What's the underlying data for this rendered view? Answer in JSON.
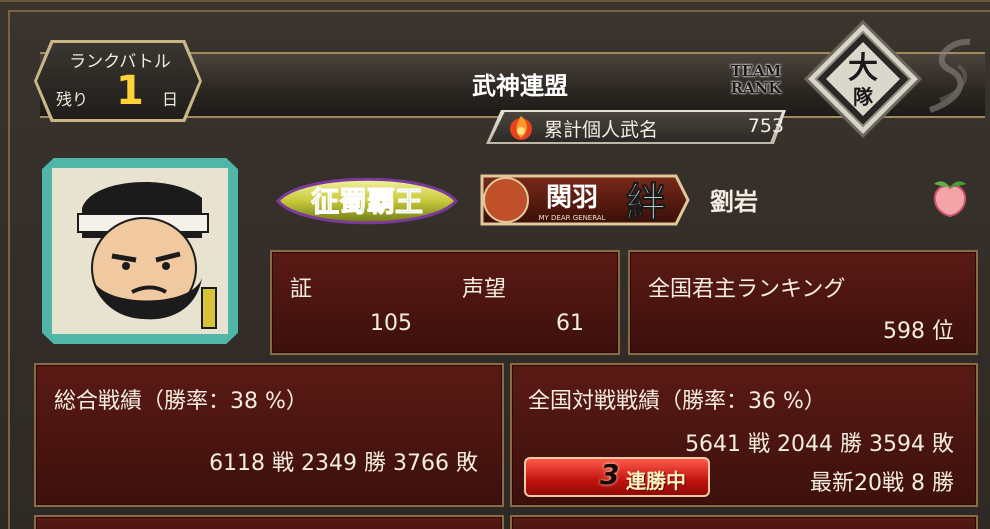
{
  "header": {
    "rank_battle_title": "ランクバトル",
    "remaining_label": "残り",
    "remaining_value": "1",
    "remaining_unit": "日",
    "alliance_name": "武神連盟",
    "team_rank_label_line1": "TEAM",
    "team_rank_label_line2": "RANK",
    "team_rank_emblem_text": "大隊",
    "merit_label": "累計個人武名",
    "merit_value": "753"
  },
  "player": {
    "name": "劉岩",
    "title_1": "征蜀覇王",
    "title_2_name": "関羽",
    "title_2_sub": "MY DEAR GENERAL",
    "title_2_kanji": "絆"
  },
  "stats": {
    "proof_label": "証",
    "proof_value": "105",
    "fame_label": "声望",
    "fame_value": "61",
    "national_ranking_label": "全国君主ランキング",
    "national_ranking_value": "598 位",
    "overall_record_title": "総合戦績（勝率：38 %）",
    "overall_record_line": "6118 戦 2349 勝 3766 敗",
    "national_record_title": "全国対戦戦績（勝率：36 %）",
    "national_record_line": "5641 戦 2044 勝 3594 敗",
    "latest_record_line": "最新20戦 8 勝",
    "streak_number": "3",
    "streak_label": "連勝中"
  },
  "colors": {
    "accent_gold": "#ffd23a",
    "box_red": "#5a1a14",
    "frame_teal": "#4fb6a8"
  },
  "icons": [
    "merit-flame-icon",
    "peach-icon",
    "team-rank-emblem-icon"
  ]
}
